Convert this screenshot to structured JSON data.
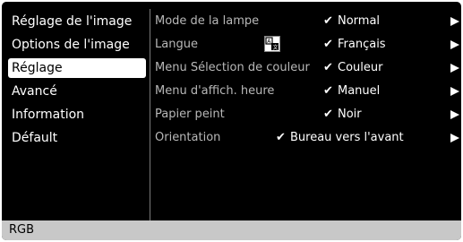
{
  "sidebar": {
    "items": [
      {
        "label": "Réglage de l'image"
      },
      {
        "label": "Options de l'image"
      },
      {
        "label": "Réglage"
      },
      {
        "label": "Avancé"
      },
      {
        "label": "Information"
      },
      {
        "label": "Défault"
      }
    ],
    "selected": "Réglage"
  },
  "settings": [
    {
      "label": "Mode de la lampe",
      "value": "Normal"
    },
    {
      "label": "Langue",
      "value": "Français",
      "icon": "language-icon"
    },
    {
      "label": "Menu Sélection de couleur",
      "value": "Couleur"
    },
    {
      "label": "Menu d'affich. heure",
      "value": "Manuel"
    },
    {
      "label": "Papier peint",
      "value": "Noir"
    },
    {
      "label": "Orientation",
      "value": "Bureau vers l'avant"
    }
  ],
  "status": {
    "source": "RGB"
  },
  "colors": {
    "background": "#000000",
    "selected_bg": "#ffffff",
    "label": "#b8b8b8",
    "status_bar": "#c8c8c8"
  }
}
